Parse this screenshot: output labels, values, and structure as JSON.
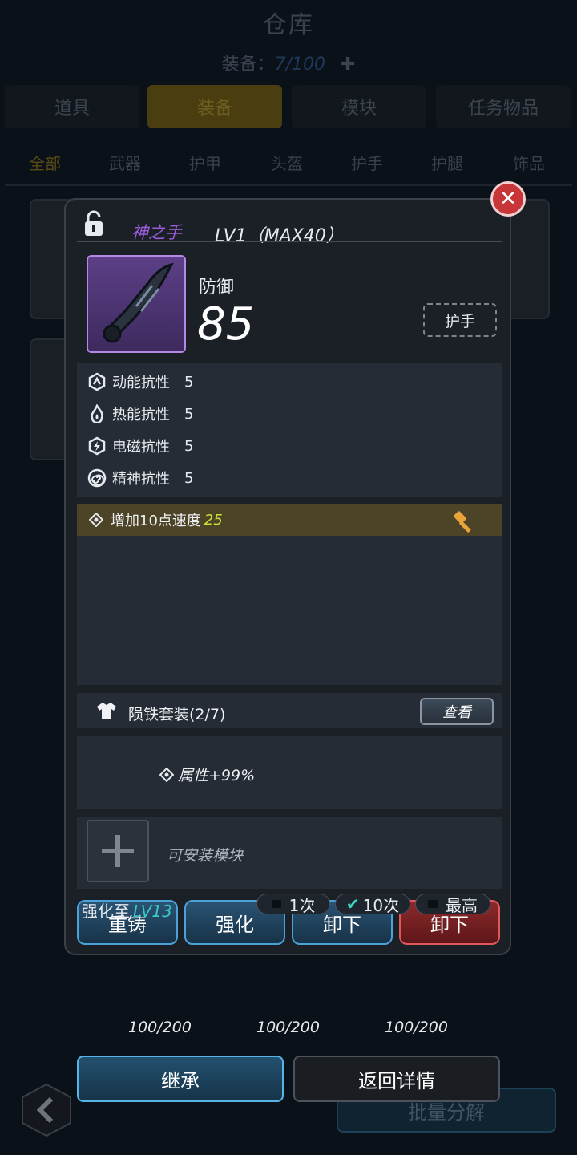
{
  "page": {
    "title": "仓库",
    "count_label": "装备：",
    "count_value": "7/100"
  },
  "tabs": [
    {
      "label": "道具"
    },
    {
      "label": "装备"
    },
    {
      "label": "模块"
    },
    {
      "label": "任务物品"
    }
  ],
  "subtabs": [
    {
      "label": "全部"
    },
    {
      "label": "武器"
    },
    {
      "label": "护甲"
    },
    {
      "label": "头盔"
    },
    {
      "label": "护手"
    },
    {
      "label": "护腿"
    },
    {
      "label": "饰品"
    }
  ],
  "dialog": {
    "name": "神之手",
    "level": "LV1（MAX40）",
    "defense_label": "防御",
    "defense_value": "85",
    "slot_tag": "护手",
    "resistances": [
      {
        "label": "动能抗性",
        "value": "5",
        "icon": "kinetic-icon"
      },
      {
        "label": "热能抗性",
        "value": "5",
        "icon": "flame-icon"
      },
      {
        "label": "电磁抗性",
        "value": "5",
        "icon": "lightning-icon"
      },
      {
        "label": "精神抗性",
        "value": "5",
        "icon": "spiral-icon"
      }
    ],
    "bonus": {
      "text": "增加10点速度",
      "value": "25"
    },
    "set": {
      "name": "陨铁套装(2/7)",
      "view_label": "查看",
      "effect": "属性+99%"
    },
    "module": {
      "hint": "可安装模块"
    },
    "enhance": {
      "prefix": "强化至",
      "level": "LV13"
    },
    "pills": [
      {
        "label": "1次"
      },
      {
        "label": "10次"
      },
      {
        "label": "最高"
      }
    ],
    "buttons": [
      {
        "label": "重铸"
      },
      {
        "label": "强化"
      },
      {
        "label": "卸下"
      },
      {
        "label": "卸下"
      }
    ]
  },
  "bottom": {
    "counters": [
      "100/200",
      "100/200",
      "100/200"
    ],
    "inherit_label": "继承",
    "back_label": "返回详情",
    "batch_label": "批量分解"
  },
  "colors": {
    "accent_gold": "#d9a52a",
    "accent_purple": "#9a5cd8",
    "accent_cyan": "#38c9c9"
  }
}
